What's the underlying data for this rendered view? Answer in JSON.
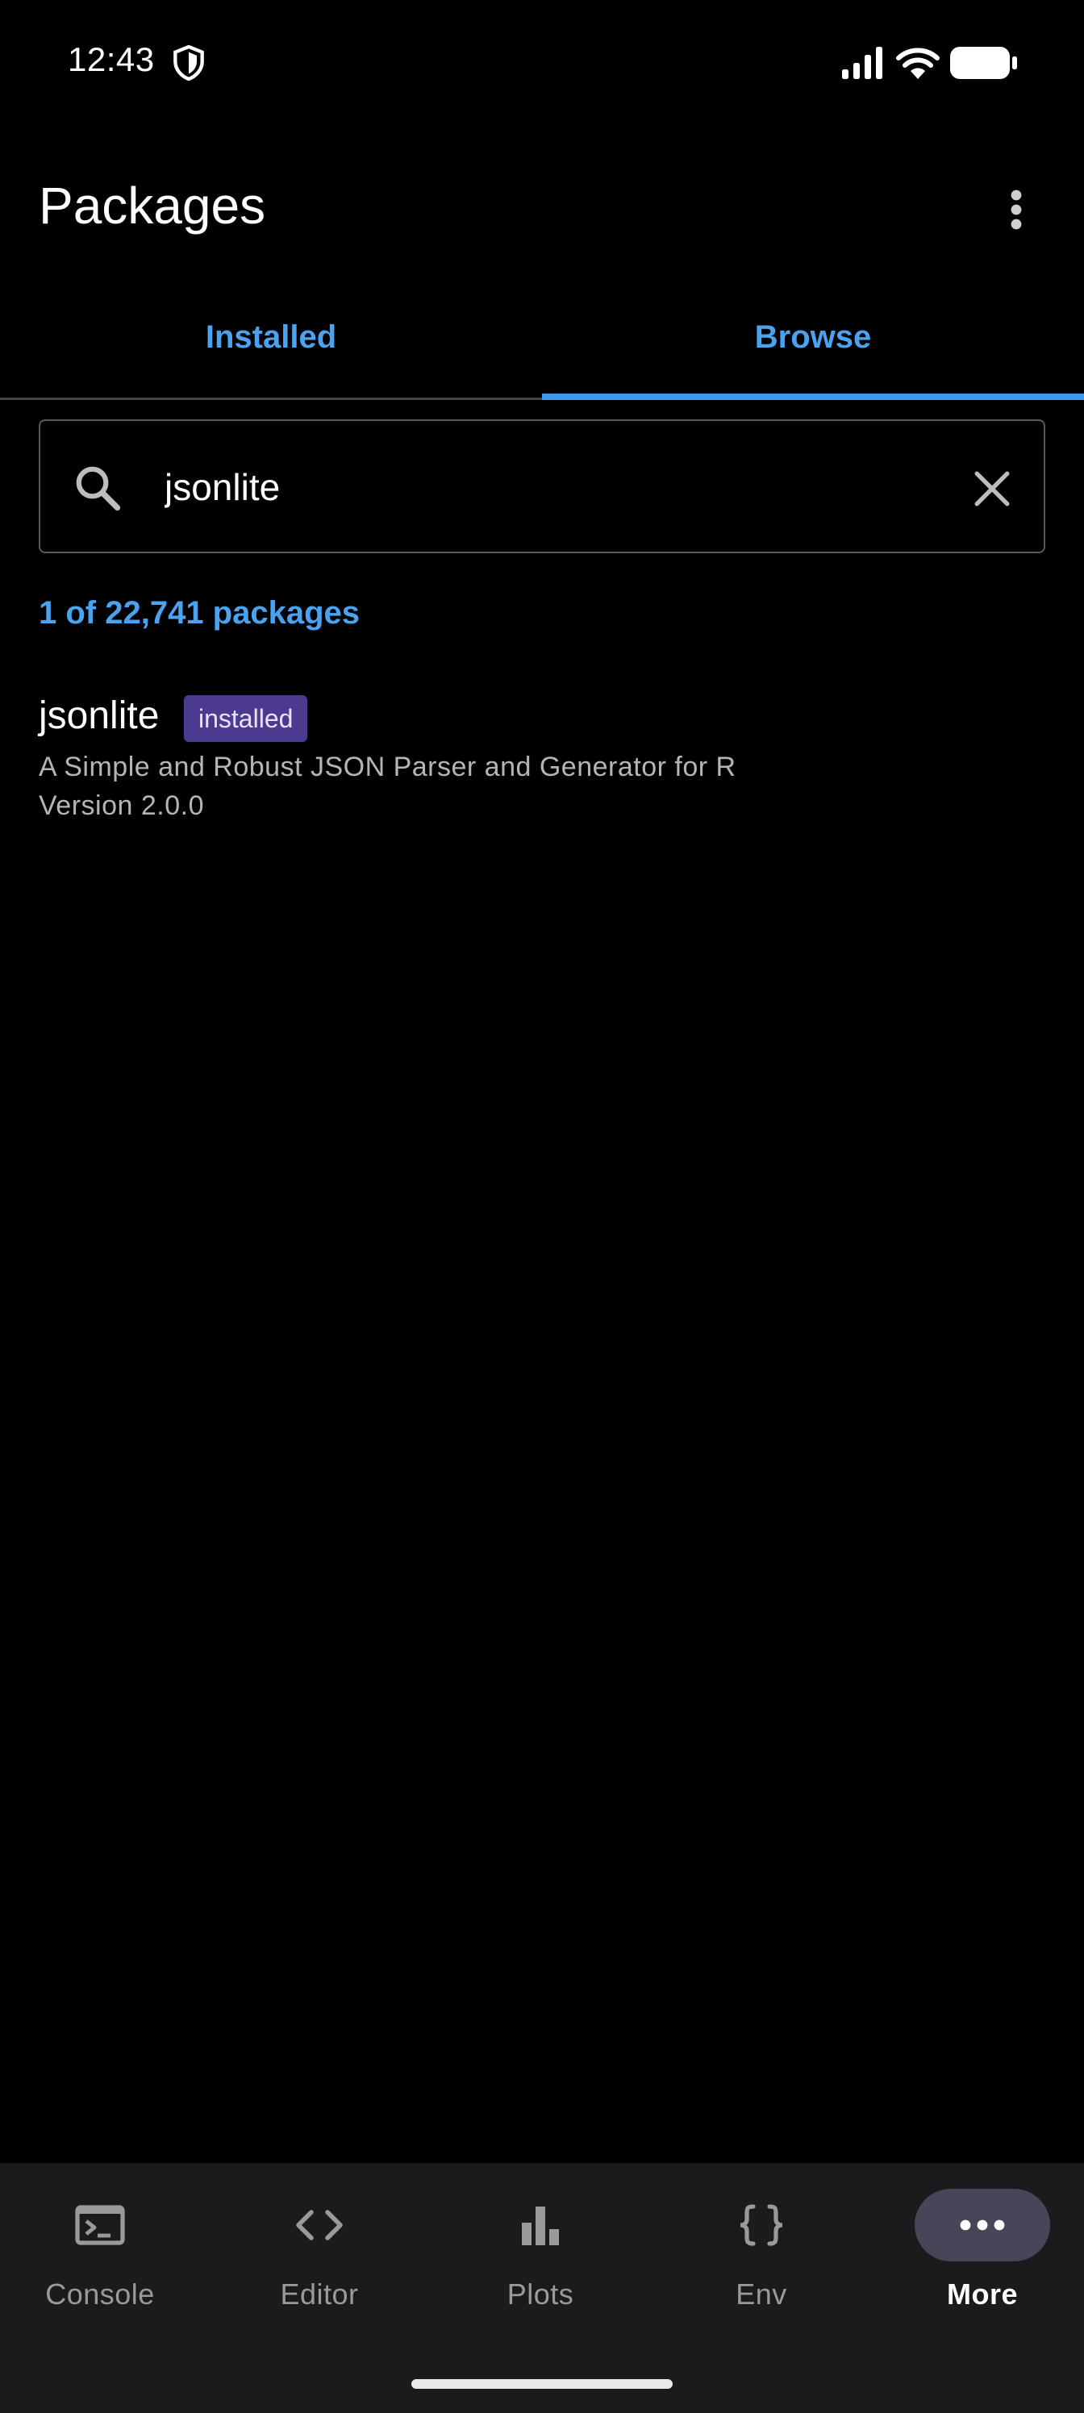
{
  "status_bar": {
    "time": "12:43",
    "icons": [
      "shield-icon",
      "signal-icon",
      "wifi-icon",
      "battery-icon"
    ]
  },
  "app_bar": {
    "title": "Packages",
    "overflow_icon": "more-vert-icon"
  },
  "tabs": [
    {
      "label": "Installed",
      "selected": false
    },
    {
      "label": "Browse",
      "selected": true
    }
  ],
  "search": {
    "value": "jsonlite",
    "placeholder": "",
    "icon": "search-icon",
    "clear_icon": "close-icon"
  },
  "results": {
    "count_text": "1 of 22,741 packages",
    "items": [
      {
        "name": "jsonlite",
        "badge": "installed",
        "description": "A Simple and Robust JSON Parser and Generator for R",
        "version": "Version 2.0.0"
      }
    ]
  },
  "bottom_nav": {
    "items": [
      {
        "label": "Console",
        "icon": "terminal-icon",
        "active": false
      },
      {
        "label": "Editor",
        "icon": "code-icon",
        "active": false
      },
      {
        "label": "Plots",
        "icon": "bar-chart-icon",
        "active": false
      },
      {
        "label": "Env",
        "icon": "braces-icon",
        "active": false
      },
      {
        "label": "More",
        "icon": "more-horiz-icon",
        "active": true
      }
    ]
  },
  "colors": {
    "background": "#000000",
    "accent": "#4aa3f0",
    "tab_indicator": "#3d9bef",
    "badge_bg": "#4b3a8f",
    "nav_bg": "#1b1b1e",
    "nav_active_pill": "#4a4458",
    "secondary_text": "#b5b5b5"
  }
}
